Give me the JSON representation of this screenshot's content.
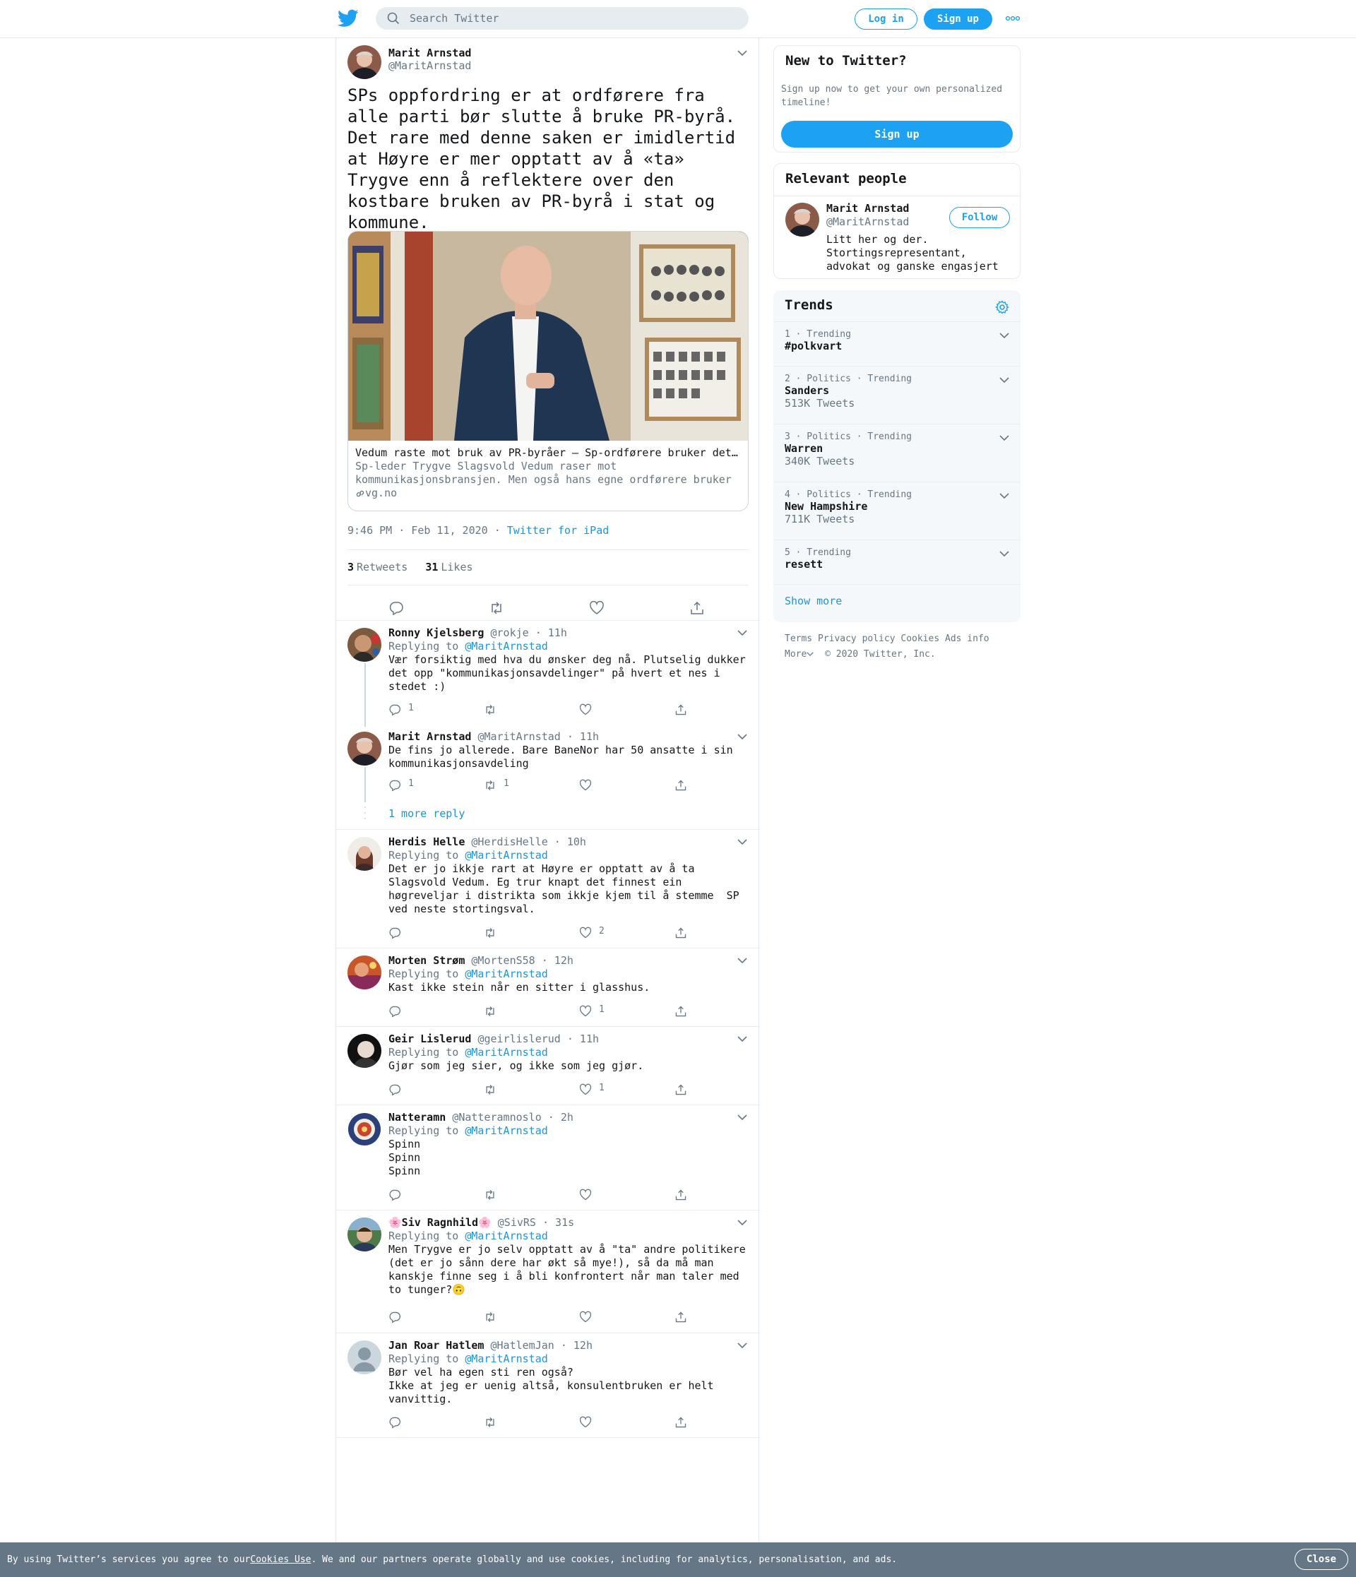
{
  "header": {
    "search_placeholder": "Search Twitter",
    "login_label": "Log in",
    "signup_label": "Sign up"
  },
  "tweet": {
    "name": "Marit Arnstad",
    "handle": "@MaritArnstad",
    "text": "SPs oppfordring er at ordførere fra alle parti bør slutte å bruke PR-byrå. Det rare med denne saken er imidlertid at Høyre er mer opptatt av å «ta» Trygve enn å reflektere over den kostbare bruken av PR-byrå i stat og kommune.",
    "card": {
      "title": "Vedum raste mot bruk av PR-byråer – Sp-ordførere bruker dette selv",
      "description": "Sp-leder Trygve Slagsvold Vedum raser mot kommunikasjonsbransjen. Men også hans egne ordførere bruker PR-byråer.",
      "domain": "vg.no"
    },
    "time": "9:46 PM · Feb 11, 2020",
    "sep": "·",
    "source": "Twitter for iPad",
    "retweets_count": "3",
    "retweets_label": "Retweets",
    "likes_count": "31",
    "likes_label": "Likes"
  },
  "replying_label": "Replying to",
  "replies": [
    {
      "name": "Ronny Kjelsberg",
      "meta": "@rokje · 11h",
      "replying_to": "@MaritArnstad",
      "text": "Vær forsiktig med hva du ønsker deg nå. Plutselig dukker det opp \"kommunikasjonsavdelinger\" på hvert et nes i stedet :)",
      "reply_count": "1",
      "retweet_count": "",
      "like_count": ""
    },
    {
      "name": "Marit Arnstad",
      "meta": "@MaritArnstad · 11h",
      "replying_to": "",
      "text": "De fins jo allerede. Bare BaneNor har 50 ansatte i sin kommunikasjonsavdeling",
      "reply_count": "1",
      "retweet_count": "1",
      "like_count": "",
      "more_replies": "1 more reply"
    },
    {
      "name": "Herdis Helle",
      "meta": "@HerdisHelle · 10h",
      "replying_to": "@MaritArnstad",
      "text": "Det er jo ikkje rart at Høyre er opptatt av å ta Slagsvold Vedum. Eg trur knapt det finnest ein høgreveljar i distrikta som ikkje kjem til å stemme  SP ved neste stortingsval.",
      "reply_count": "",
      "retweet_count": "",
      "like_count": "2"
    },
    {
      "name": "Morten Strøm",
      "meta": "@MortenS58 · 12h",
      "replying_to": "@MaritArnstad",
      "text": "Kast ikke stein når en sitter i glasshus.",
      "reply_count": "",
      "retweet_count": "",
      "like_count": "1"
    },
    {
      "name": "Geir Lislerud",
      "meta": "@geirlislerud · 11h",
      "replying_to": "@MaritArnstad",
      "text": "Gjør som jeg sier, og ikke som jeg gjør.",
      "reply_count": "",
      "retweet_count": "",
      "like_count": "1"
    },
    {
      "name": "Natteramn",
      "meta": "@Natteramnoslo · 2h",
      "replying_to": "@MaritArnstad",
      "text": "Spinn\nSpinn\nSpinn",
      "reply_count": "",
      "retweet_count": "",
      "like_count": ""
    },
    {
      "name": "🌸Siv Ragnhild🌸",
      "meta": "@SivRS · 31s",
      "replying_to": "@MaritArnstad",
      "text": "Men Trygve er jo selv opptatt av å \"ta\" andre politikere (det er jo sånn dere har økt så mye!), så da må man kanskje finne seg i å bli konfrontert når man taler med to tunger?🙃",
      "reply_count": "",
      "retweet_count": "",
      "like_count": ""
    },
    {
      "name": "Jan Roar Hatlem",
      "meta": "@HatlemJan · 12h",
      "replying_to": "@MaritArnstad",
      "text": "Bør vel ha egen sti ren også?\nIkke at jeg er uenig altså, konsulentbruken er helt vanvittig.",
      "reply_count": "",
      "retweet_count": "",
      "like_count": ""
    }
  ],
  "sidebar": {
    "new_title": "New to Twitter?",
    "new_text": "Sign up now to get your own personalized timeline!",
    "new_button": "Sign up",
    "relevant_title": "Relevant people",
    "person": {
      "name": "Marit Arnstad",
      "handle": "@MaritArnstad",
      "bio": "Litt her og der. Stortingsrepresentant, advokat og ganske engasjert",
      "follow_label": "Follow"
    },
    "trends_title": "Trends",
    "trends": [
      {
        "meta": "1 · Trending",
        "name": "#polkvart",
        "count": ""
      },
      {
        "meta": "2 · Politics · Trending",
        "name": "Sanders",
        "count": "513K Tweets"
      },
      {
        "meta": "3 · Politics · Trending",
        "name": "Warren",
        "count": "340K Tweets"
      },
      {
        "meta": "4 · Politics · Trending",
        "name": "New Hampshire",
        "count": "711K Tweets"
      },
      {
        "meta": "5 · Trending",
        "name": "resett",
        "count": ""
      }
    ],
    "show_more": "Show more",
    "footer_links": [
      "Terms",
      "Privacy policy",
      "Cookies",
      "Ads info"
    ],
    "footer_more": "More",
    "copyright": "© 2020 Twitter, Inc."
  },
  "cookie": {
    "text_before": "By using Twitter’s services you agree to our ",
    "link": "Cookies Use",
    "text_after": ". We and our partners operate globally and use cookies, including for analytics, personalisation, and ads.",
    "close_label": "Close"
  },
  "colors": {
    "accent": "#1da1f2",
    "link": "#1b95e0",
    "muted": "#657786",
    "cookie_bar": "#657786"
  }
}
